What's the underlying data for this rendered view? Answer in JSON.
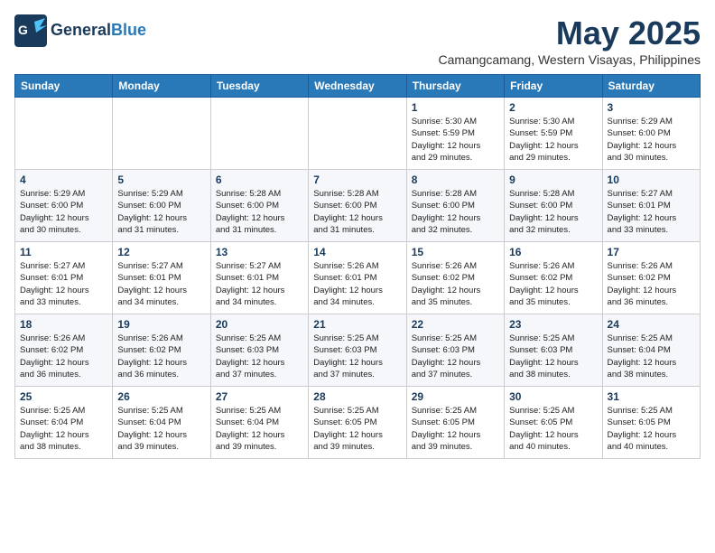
{
  "header": {
    "logo_line1": "General",
    "logo_line2": "Blue",
    "month_title": "May 2025",
    "location": "Camangcamang, Western Visayas, Philippines"
  },
  "days_of_week": [
    "Sunday",
    "Monday",
    "Tuesday",
    "Wednesday",
    "Thursday",
    "Friday",
    "Saturday"
  ],
  "weeks": [
    [
      {
        "day": "",
        "info": ""
      },
      {
        "day": "",
        "info": ""
      },
      {
        "day": "",
        "info": ""
      },
      {
        "day": "",
        "info": ""
      },
      {
        "day": "1",
        "info": "Sunrise: 5:30 AM\nSunset: 5:59 PM\nDaylight: 12 hours\nand 29 minutes."
      },
      {
        "day": "2",
        "info": "Sunrise: 5:30 AM\nSunset: 5:59 PM\nDaylight: 12 hours\nand 29 minutes."
      },
      {
        "day": "3",
        "info": "Sunrise: 5:29 AM\nSunset: 6:00 PM\nDaylight: 12 hours\nand 30 minutes."
      }
    ],
    [
      {
        "day": "4",
        "info": "Sunrise: 5:29 AM\nSunset: 6:00 PM\nDaylight: 12 hours\nand 30 minutes."
      },
      {
        "day": "5",
        "info": "Sunrise: 5:29 AM\nSunset: 6:00 PM\nDaylight: 12 hours\nand 31 minutes."
      },
      {
        "day": "6",
        "info": "Sunrise: 5:28 AM\nSunset: 6:00 PM\nDaylight: 12 hours\nand 31 minutes."
      },
      {
        "day": "7",
        "info": "Sunrise: 5:28 AM\nSunset: 6:00 PM\nDaylight: 12 hours\nand 31 minutes."
      },
      {
        "day": "8",
        "info": "Sunrise: 5:28 AM\nSunset: 6:00 PM\nDaylight: 12 hours\nand 32 minutes."
      },
      {
        "day": "9",
        "info": "Sunrise: 5:28 AM\nSunset: 6:00 PM\nDaylight: 12 hours\nand 32 minutes."
      },
      {
        "day": "10",
        "info": "Sunrise: 5:27 AM\nSunset: 6:01 PM\nDaylight: 12 hours\nand 33 minutes."
      }
    ],
    [
      {
        "day": "11",
        "info": "Sunrise: 5:27 AM\nSunset: 6:01 PM\nDaylight: 12 hours\nand 33 minutes."
      },
      {
        "day": "12",
        "info": "Sunrise: 5:27 AM\nSunset: 6:01 PM\nDaylight: 12 hours\nand 34 minutes."
      },
      {
        "day": "13",
        "info": "Sunrise: 5:27 AM\nSunset: 6:01 PM\nDaylight: 12 hours\nand 34 minutes."
      },
      {
        "day": "14",
        "info": "Sunrise: 5:26 AM\nSunset: 6:01 PM\nDaylight: 12 hours\nand 34 minutes."
      },
      {
        "day": "15",
        "info": "Sunrise: 5:26 AM\nSunset: 6:02 PM\nDaylight: 12 hours\nand 35 minutes."
      },
      {
        "day": "16",
        "info": "Sunrise: 5:26 AM\nSunset: 6:02 PM\nDaylight: 12 hours\nand 35 minutes."
      },
      {
        "day": "17",
        "info": "Sunrise: 5:26 AM\nSunset: 6:02 PM\nDaylight: 12 hours\nand 36 minutes."
      }
    ],
    [
      {
        "day": "18",
        "info": "Sunrise: 5:26 AM\nSunset: 6:02 PM\nDaylight: 12 hours\nand 36 minutes."
      },
      {
        "day": "19",
        "info": "Sunrise: 5:26 AM\nSunset: 6:02 PM\nDaylight: 12 hours\nand 36 minutes."
      },
      {
        "day": "20",
        "info": "Sunrise: 5:25 AM\nSunset: 6:03 PM\nDaylight: 12 hours\nand 37 minutes."
      },
      {
        "day": "21",
        "info": "Sunrise: 5:25 AM\nSunset: 6:03 PM\nDaylight: 12 hours\nand 37 minutes."
      },
      {
        "day": "22",
        "info": "Sunrise: 5:25 AM\nSunset: 6:03 PM\nDaylight: 12 hours\nand 37 minutes."
      },
      {
        "day": "23",
        "info": "Sunrise: 5:25 AM\nSunset: 6:03 PM\nDaylight: 12 hours\nand 38 minutes."
      },
      {
        "day": "24",
        "info": "Sunrise: 5:25 AM\nSunset: 6:04 PM\nDaylight: 12 hours\nand 38 minutes."
      }
    ],
    [
      {
        "day": "25",
        "info": "Sunrise: 5:25 AM\nSunset: 6:04 PM\nDaylight: 12 hours\nand 38 minutes."
      },
      {
        "day": "26",
        "info": "Sunrise: 5:25 AM\nSunset: 6:04 PM\nDaylight: 12 hours\nand 39 minutes."
      },
      {
        "day": "27",
        "info": "Sunrise: 5:25 AM\nSunset: 6:04 PM\nDaylight: 12 hours\nand 39 minutes."
      },
      {
        "day": "28",
        "info": "Sunrise: 5:25 AM\nSunset: 6:05 PM\nDaylight: 12 hours\nand 39 minutes."
      },
      {
        "day": "29",
        "info": "Sunrise: 5:25 AM\nSunset: 6:05 PM\nDaylight: 12 hours\nand 39 minutes."
      },
      {
        "day": "30",
        "info": "Sunrise: 5:25 AM\nSunset: 6:05 PM\nDaylight: 12 hours\nand 40 minutes."
      },
      {
        "day": "31",
        "info": "Sunrise: 5:25 AM\nSunset: 6:05 PM\nDaylight: 12 hours\nand 40 minutes."
      }
    ]
  ]
}
